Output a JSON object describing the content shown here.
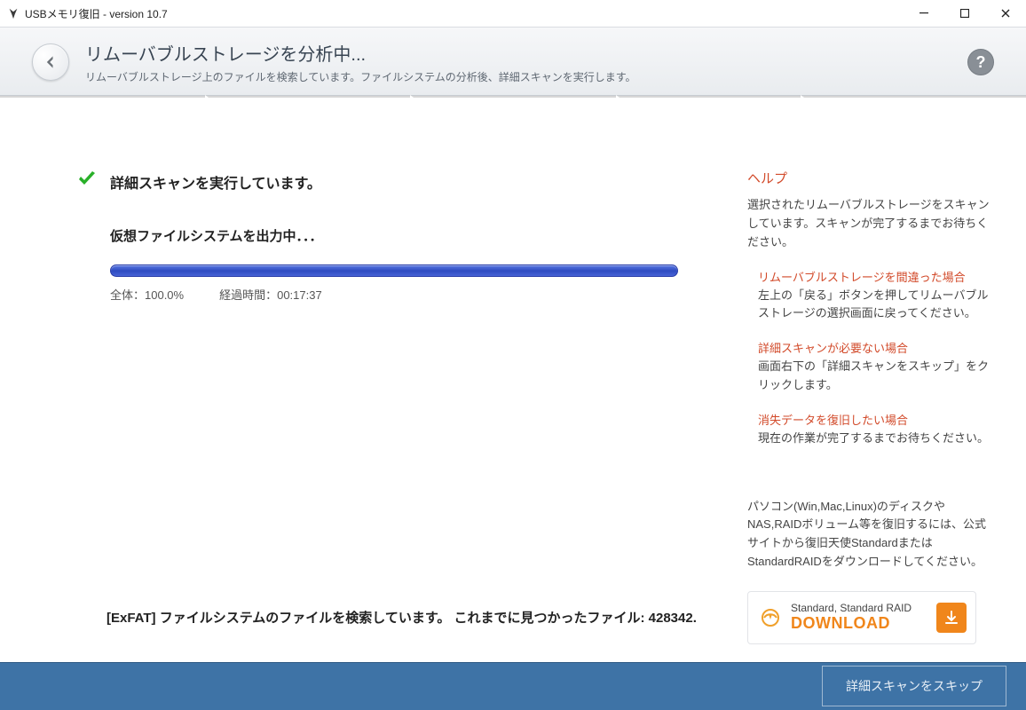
{
  "titlebar": {
    "title": "USBメモリ復旧 - version 10.7"
  },
  "header": {
    "title": "リムーバブルストレージを分析中...",
    "subtitle": "リムーバブルストレージ上のファイルを検索しています。ファイルシステムの分析後、詳細スキャンを実行します。"
  },
  "scan": {
    "running_label": "詳細スキャンを実行しています。",
    "sub_status": "仮想ファイルシステムを出力中．．．",
    "progress_percent": 100.0,
    "overall_label": "全体：100.0%",
    "elapsed_label": "経過時間：00:17:37",
    "filesystem_status": "[ExFAT] ファイルシステムのファイルを検索しています。 これまでに見つかったファイル: 428342."
  },
  "help": {
    "title": "ヘルプ",
    "intro": "選択されたリムーバブルストレージをスキャンしています。スキャンが完了するまでお待ちください。",
    "sections": [
      {
        "title": "リムーバブルストレージを間違った場合",
        "body": "左上の「戻る」ボタンを押してリムーバブルストレージの選択画面に戻ってください。"
      },
      {
        "title": "詳細スキャンが必要ない場合",
        "body": "画面右下の「詳細スキャンをスキップ」をクリックします。"
      },
      {
        "title": "消失データを復旧したい場合",
        "body": "現在の作業が完了するまでお待ちください。"
      }
    ],
    "promo": "パソコン(Win,Mac,Linux)のディスクやNAS,RAIDボリューム等を復旧するには、公式サイトから復旧天使StandardまたはStandardRAIDをダウンロードしてください。",
    "download": {
      "line1": "Standard, Standard RAID",
      "line2": "DOWNLOAD"
    }
  },
  "footer": {
    "skip_label": "詳細スキャンをスキップ"
  }
}
